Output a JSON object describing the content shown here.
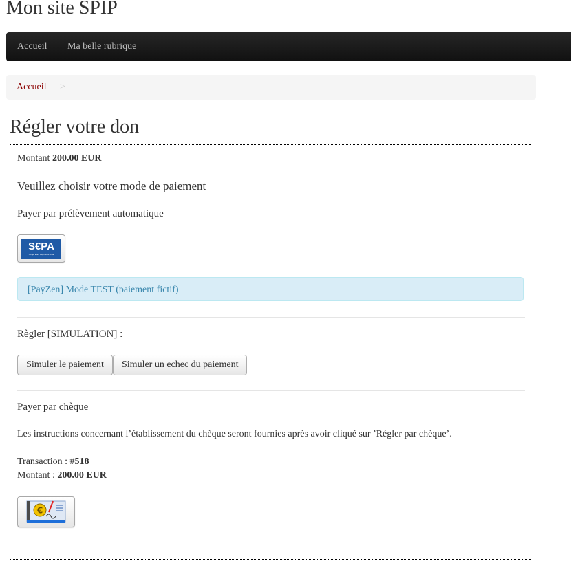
{
  "site": {
    "title": "Mon site SPIP"
  },
  "nav": {
    "items": [
      "Accueil",
      "Ma belle rubrique"
    ]
  },
  "breadcrumb": {
    "home": "Accueil",
    "separator": ">"
  },
  "page": {
    "title": "Régler votre don"
  },
  "amount": {
    "label": "Montant",
    "value": "200.00 EUR"
  },
  "payment": {
    "choose_heading": "Veuillez choisir votre mode de paiement",
    "sepa": {
      "heading": "Payer par prélèvement automatique",
      "logo_text": "S€PA",
      "logo_subtext": "Single Euro Payments Area",
      "logo_icon": "sepa-logo-icon"
    },
    "payzen_notice": "[PayZen] Mode TEST (paiement fictif)",
    "simulation": {
      "heading": "Règler [SIMULATION] :",
      "simulate_button": "Simuler le paiement",
      "simulate_fail_button": "Simuler un echec du paiement"
    },
    "cheque": {
      "heading": "Payer par chèque",
      "instructions": "Les instructions concernant l’établissement du chèque seront fournies après avoir cliqué sur ’Régler par chèque’.",
      "transaction_label": "Transaction : #",
      "transaction_number": "518",
      "amount_label": "Montant :",
      "amount_value": "200.00 EUR",
      "logo_icon": "cheque-euro-icon"
    }
  },
  "colors": {
    "link": "#8b0000",
    "navbar": "#1b1b1b",
    "alert_bg": "#d9edf7",
    "alert_text": "#3a87ad",
    "sepa_blue": "#1f5aa6",
    "sepa_yellow": "#ffcc00"
  }
}
